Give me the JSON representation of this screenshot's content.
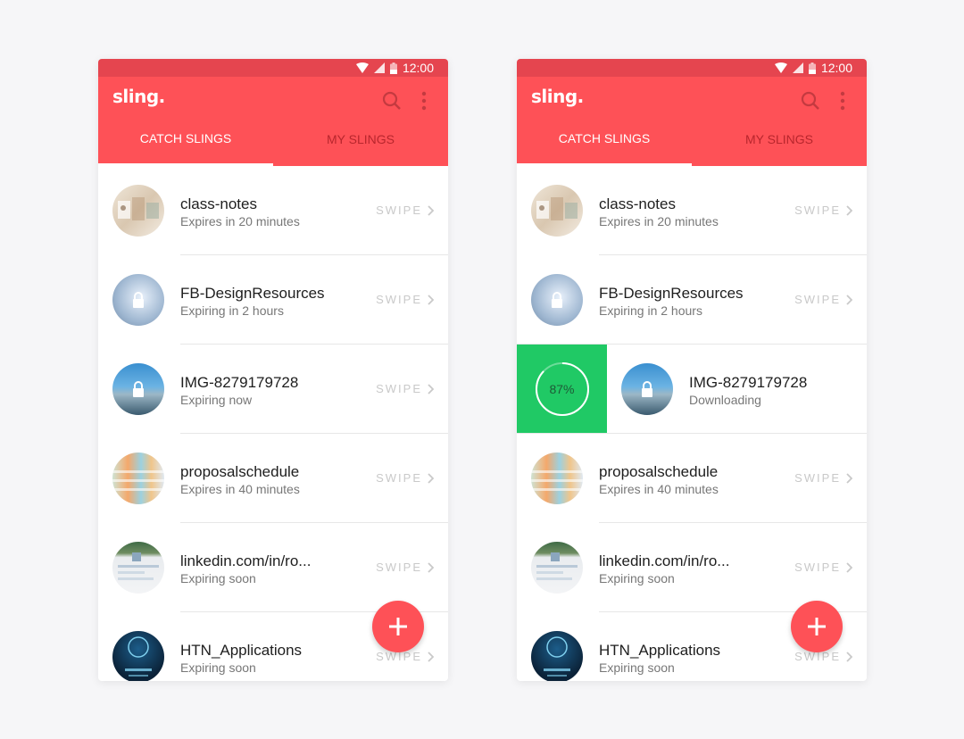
{
  "colors": {
    "primary": "#fe5157",
    "status_bar": "#e5454f",
    "progress_green": "#20c965"
  },
  "status": {
    "time": "12:00"
  },
  "app": {
    "logo": "sling."
  },
  "tabs": {
    "catch": "CATCH SLINGS",
    "mine": "MY SLINGS"
  },
  "swipe_label": "SWIPE",
  "items": [
    {
      "title": "class-notes",
      "subtitle": "Expires in 20 minutes",
      "locked": false,
      "thumb": "notes"
    },
    {
      "title": "FB-DesignResources",
      "subtitle": "Expiring in 2 hours",
      "locked": true,
      "thumb": "blur-light"
    },
    {
      "title": "IMG-8279179728",
      "subtitle": "Expiring now",
      "locked": true,
      "thumb": "blur-blue"
    },
    {
      "title": "proposalschedule",
      "subtitle": "Expires in 40 minutes",
      "locked": false,
      "thumb": "schedule"
    },
    {
      "title": "linkedin.com/in/ro...",
      "subtitle": "Expiring soon",
      "locked": false,
      "thumb": "linkedin"
    },
    {
      "title": "HTN_Applications",
      "subtitle": "Expiring soon",
      "locked": false,
      "thumb": "htn"
    }
  ],
  "download": {
    "title": "IMG-8279179728",
    "subtitle": "Downloading",
    "progress_label": "87%",
    "progress": 0.87
  }
}
